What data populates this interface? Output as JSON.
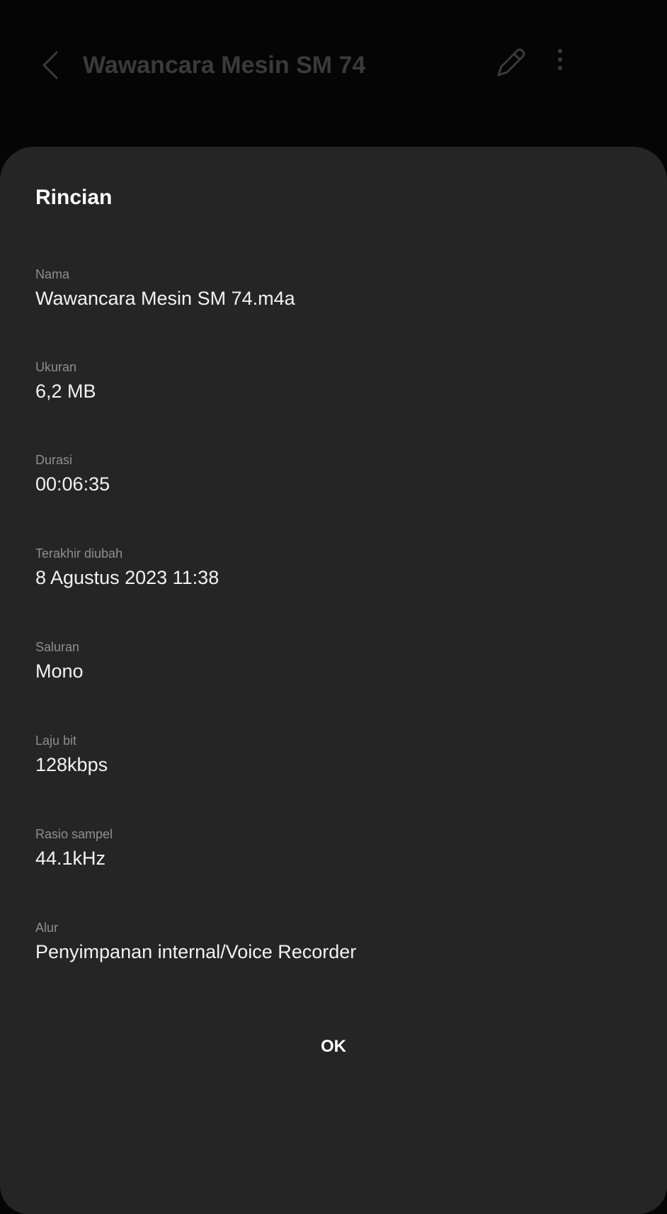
{
  "appbar": {
    "title": "Wawancara Mesin SM 74",
    "back_icon": "chevron-left-icon",
    "edit_icon": "pencil-icon",
    "more_icon": "more-vertical-icon"
  },
  "dialog": {
    "title": "Rincian",
    "fields": [
      {
        "label": "Nama",
        "value": "Wawancara Mesin SM 74.m4a"
      },
      {
        "label": "Ukuran",
        "value": "6,2 MB"
      },
      {
        "label": "Durasi",
        "value": "00:06:35"
      },
      {
        "label": "Terakhir diubah",
        "value": "8 Agustus 2023 11:38"
      },
      {
        "label": "Saluran",
        "value": "Mono"
      },
      {
        "label": "Laju bit",
        "value": "128kbps"
      },
      {
        "label": "Rasio sampel",
        "value": "44.1kHz"
      },
      {
        "label": "Alur",
        "value": "Penyimpanan internal/Voice Recorder"
      }
    ],
    "ok_label": "OK"
  },
  "colors": {
    "background": "#050505",
    "dialog": "#252525",
    "label": "#8e8e8e",
    "value": "#f2f2f2",
    "dimmed_appbar": "#3a3a3a"
  }
}
